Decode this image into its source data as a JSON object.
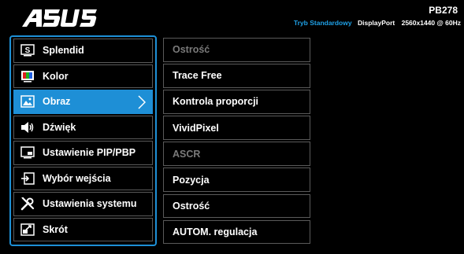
{
  "brand": "ASUS",
  "model": "PB278",
  "status": {
    "mode": "Tryb Standardowy",
    "input": "DisplayPort",
    "resolution": "2560x1440 @ 60Hz"
  },
  "colors": {
    "accent": "#1e8fd6",
    "mode_text": "#1fa0e6",
    "disabled_text": "#7a7a7a",
    "background": "#000000"
  },
  "main_menu": [
    {
      "label": "Splendid",
      "icon": "splendid-icon",
      "active": false
    },
    {
      "label": "Kolor",
      "icon": "color-icon",
      "active": false
    },
    {
      "label": "Obraz",
      "icon": "image-icon",
      "active": true
    },
    {
      "label": "Dźwięk",
      "icon": "speaker-icon",
      "active": false
    },
    {
      "label": "Ustawienie PIP/PBP",
      "icon": "pip-icon",
      "active": false
    },
    {
      "label": "Wybór wejścia",
      "icon": "input-select-icon",
      "active": false
    },
    {
      "label": "Ustawienia systemu",
      "icon": "wrench-screwdriver-icon",
      "active": false
    },
    {
      "label": "Skrót",
      "icon": "shortcut-icon",
      "active": false
    }
  ],
  "sub_menu": [
    {
      "label": "Ostrość",
      "enabled": false
    },
    {
      "label": "Trace Free",
      "enabled": true
    },
    {
      "label": "Kontrola proporcji",
      "enabled": true
    },
    {
      "label": "VividPixel",
      "enabled": true
    },
    {
      "label": "ASCR",
      "enabled": false
    },
    {
      "label": "Pozycja",
      "enabled": true
    },
    {
      "label": "Ostrość",
      "enabled": true
    },
    {
      "label": "AUTOM. regulacja",
      "enabled": true
    }
  ]
}
